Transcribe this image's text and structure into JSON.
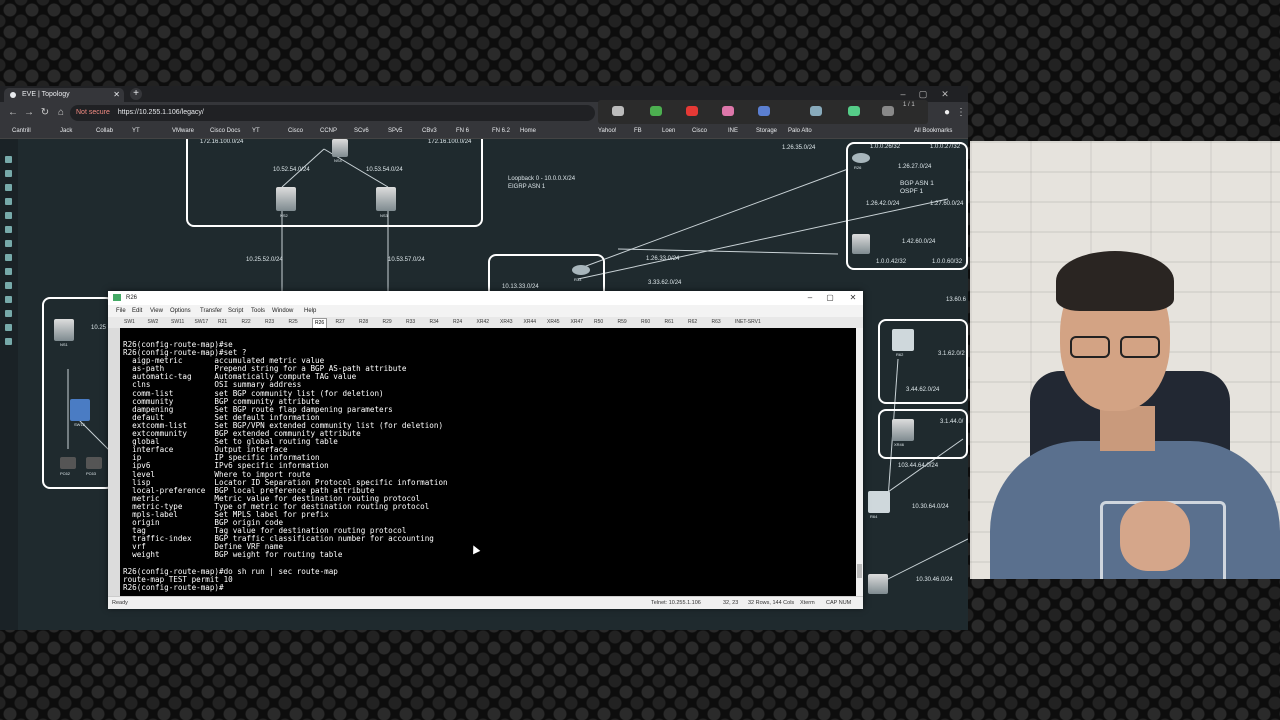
{
  "browser": {
    "tab_title": "EVE | Topology",
    "not_secure": "Not secure",
    "url": "https://10.255.1.106/legacy/",
    "bookmarks": [
      "Cantrill",
      "Jack",
      "Collab",
      "YT",
      "VMware",
      "Cisco Docs",
      "YT",
      "Cisco",
      "CCNP",
      "SCv6",
      "SPv5",
      "CBv3",
      "FN 6",
      "FN 6.2",
      "Home",
      "Yahoo!",
      "FB",
      "Loen",
      "Cisco",
      "INE",
      "Storage",
      "Palo Alto",
      "All Bookmarks"
    ],
    "page_counter": "1 / 1"
  },
  "topology": {
    "labels": {
      "net_172_left": "172.16.100.0/24",
      "net_172_right": "172.16.100.0/24",
      "net_10_52_54": "10.52.54.0/24",
      "net_10_53_54": "10.53.54.0/24",
      "net_10_25_52": "10.25.52.0/24",
      "net_10_53_57": "10.53.57.0/24",
      "loopback": "Loopback 0 - 10.0.0.X/24",
      "eigrp": "EIGRP ASN 1",
      "net_10_13_33": "10.13.33.0/24",
      "net_1_26_33": "1.26.33.0/24",
      "net_3_33_62": "3.33.62.0/24",
      "net_1_26_35": "1.26.35.0/24",
      "net_1_0_0_26": "1.0.0.26/32",
      "net_1_0_0_27": "1.0.0.27/32",
      "net_1_26_27": "1.26.27.0/24",
      "bgp_asn": "BGP ASN 1",
      "ospf": "OSPF 1",
      "net_1_26_42": "1.26.42.0/24",
      "net_1_27_60": "1.27.60.0/24",
      "net_1_42_60": "1.42.60.0/24",
      "net_1_0_0_42": "1.0.0.42/32",
      "net_1_0_0_60": "1.0.0.60/32",
      "net_13_60_6": "13.60.6",
      "net_3_1_62": "3.1.62.0/2",
      "net_3_44_62": "3.44.62.0/24",
      "net_3_1_44": "3.1.44.0/",
      "net_103_44_64": "103.44.64.0/24",
      "net_10_30_64": "10.30.64.0/24",
      "net_10_30_46": "10.30.46.0/24",
      "net_10_25": "10.25",
      "node_ns4": "NS4",
      "node_ns2": "NS2",
      "node_ns3": "NS3",
      "node_ns1": "NS1",
      "node_sw12": "SW12",
      "node_pc62": "PC62",
      "node_pc63": "PC63",
      "node_r33": "R33",
      "node_r26": "R26",
      "node_r62": "R62",
      "node_xr46": "XR46",
      "node_r64": "R64"
    }
  },
  "terminal": {
    "title": "R26",
    "menu": [
      "File",
      "Edit",
      "View",
      "Options",
      "Transfer",
      "Script",
      "Tools",
      "Window",
      "Help"
    ],
    "tabs": [
      "SW1",
      "SW2",
      "SW11",
      "SW17",
      "R21",
      "R22",
      "R23",
      "R25",
      "R26",
      "R27",
      "R28",
      "R29",
      "R33",
      "R34",
      "R24",
      "XR42",
      "XR43",
      "XR44",
      "XR45",
      "XR47",
      "R50",
      "R59",
      "R60",
      "R61",
      "R62",
      "R63",
      "INET-SRV1"
    ],
    "lines": [
      "R26(config-route-map)#se",
      "R26(config-route-map)#set ?",
      "  aigp-metric       accumulated metric value",
      "  as-path           Prepend string for a BGP AS-path attribute",
      "  automatic-tag     Automatically compute TAG value",
      "  clns              OSI summary address",
      "  comm-list         set BGP community list (for deletion)",
      "  community         BGP community attribute",
      "  dampening         Set BGP route flap dampening parameters",
      "  default           Set default information",
      "  extcomm-list      Set BGP/VPN extended community list (for deletion)",
      "  extcommunity      BGP extended community attribute",
      "  global            Set to global routing table",
      "  interface         Output interface",
      "  ip                IP specific information",
      "  ipv6              IPv6 specific information",
      "  level             Where to import route",
      "  lisp              Locator ID Separation Protocol specific information",
      "  local-preference  BGP local preference path attribute",
      "  metric            Metric value for destination routing protocol",
      "  metric-type       Type of metric for destination routing protocol",
      "  mpls-label        Set MPLS label for prefix",
      "  origin            BGP origin code",
      "  tag               Tag value for destination routing protocol",
      "  traffic-index     BGP traffic classification number for accounting",
      "  vrf               Define VRF name",
      "  weight            BGP weight for routing table",
      "",
      "R26(config-route-map)#do sh run | sec route-map",
      "route-map TEST permit 10",
      "R26(config-route-map)#"
    ],
    "status": {
      "left": "Ready",
      "conn": "Telnet: 10.255.1.106",
      "pos": "32, 23",
      "size": "32 Rows, 144 Cols",
      "term": "Xterm",
      "caps": "CAP  NUM"
    }
  }
}
